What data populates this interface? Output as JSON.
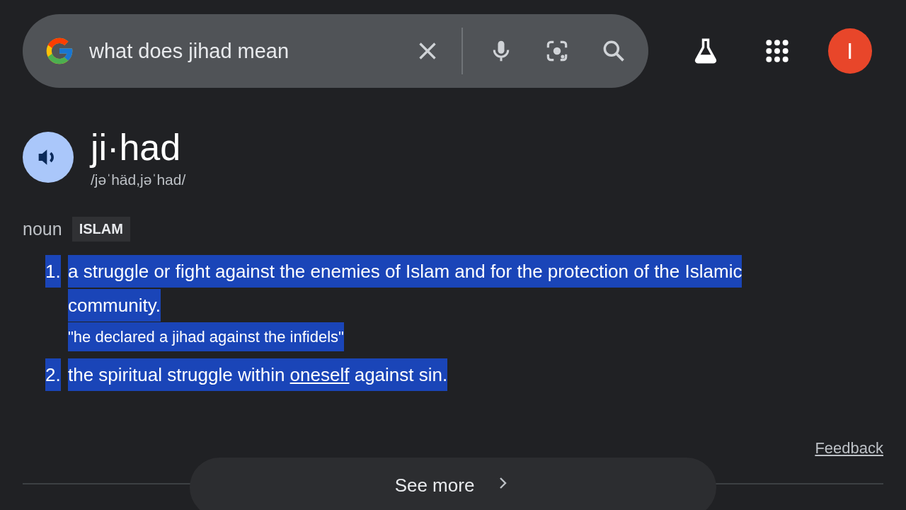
{
  "search": {
    "value": "what does jihad mean"
  },
  "avatar": {
    "letter": "I"
  },
  "entry": {
    "word": "ji·had",
    "pronunciation": "/jəˈhäd,jəˈhad/",
    "part_of_speech": "noun",
    "label": "ISLAM"
  },
  "definitions": [
    {
      "number": "1.",
      "highlighted": true,
      "parts": [
        {
          "text": "a struggle or fight against the enemies of Islam and for the protection of the Islamic community.",
          "link": false
        }
      ],
      "example": "\"he declared a jihad against the infidels\""
    },
    {
      "number": "2.",
      "highlighted": true,
      "parts": [
        {
          "text": "the spiritual struggle within ",
          "link": false
        },
        {
          "text": "oneself",
          "link": true
        },
        {
          "text": " against sin.",
          "link": false
        }
      ]
    }
  ],
  "feedback": "Feedback",
  "see_more": "See more"
}
